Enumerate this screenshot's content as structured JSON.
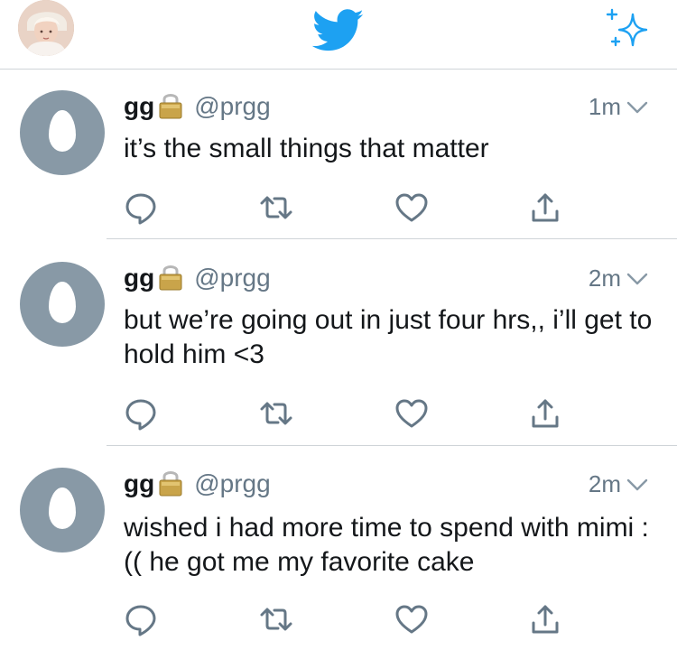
{
  "colors": {
    "brand_blue": "#1da1f2",
    "icon_gray": "#657786",
    "egg_gray": "#8899a6",
    "divider": "#cfd4d8"
  },
  "header": {
    "logo_icon": "twitter-bird-icon",
    "sparkle_icon": "sparkle-icon",
    "avatar_icon": "profile-avatar"
  },
  "tweets": [
    {
      "name": "gg",
      "handle": "@prgg",
      "time": "1m",
      "text": "it’s the small things that matter",
      "protected_icon": "lock-icon"
    },
    {
      "name": "gg",
      "handle": "@prgg",
      "time": "2m",
      "text": "but we’re going out in just four hrs,, i’ll get to hold him <3",
      "protected_icon": "lock-icon"
    },
    {
      "name": "gg",
      "handle": "@prgg",
      "time": "2m",
      "text": "wished i had more time to spend with mimi :(( he got me my favorite cake",
      "protected_icon": "lock-icon"
    }
  ]
}
